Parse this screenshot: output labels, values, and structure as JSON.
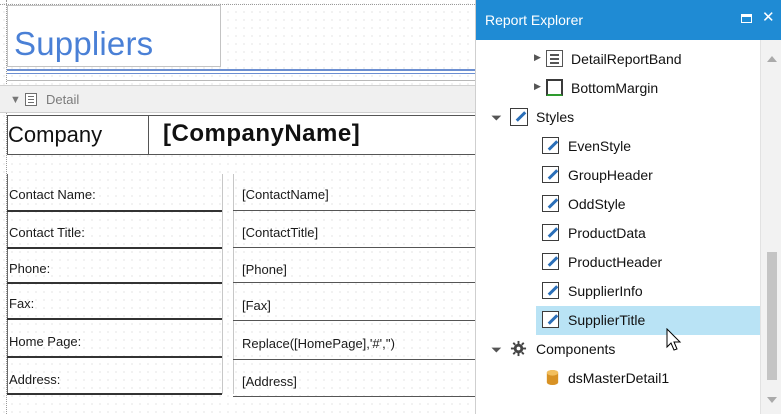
{
  "designer": {
    "report_title": "Suppliers",
    "band_label": "Detail",
    "company_label": "Company",
    "company_field": "[CompanyName]",
    "fields": [
      {
        "label": "Contact Name:",
        "value": "[ContactName]"
      },
      {
        "label": "Contact Title:",
        "value": "[ContactTitle]"
      },
      {
        "label": "Phone:",
        "value": "[Phone]"
      },
      {
        "label": "Fax:",
        "value": "[Fax]"
      },
      {
        "label": "Home Page:",
        "value": "Replace([HomePage],'#','')"
      },
      {
        "label": "Address:",
        "value": "[Address]"
      }
    ]
  },
  "explorer": {
    "title": "Report Explorer",
    "maximize_icon": "maximize-icon",
    "close_icon": "close-icon",
    "close_glyph": "✕",
    "bands": [
      {
        "label": "DetailReportBand",
        "icon": "detail-band-icon"
      },
      {
        "label": "BottomMargin",
        "icon": "bottom-margin-icon"
      }
    ],
    "styles_label": "Styles",
    "styles": [
      "EvenStyle",
      "GroupHeader",
      "OddStyle",
      "ProductData",
      "ProductHeader",
      "SupplierInfo",
      "SupplierTitle"
    ],
    "selected_style": "SupplierTitle",
    "components_label": "Components",
    "components": [
      "dsMasterDetail1"
    ]
  },
  "colors": {
    "title_blue": "#4a80d6",
    "panel_header": "#1f8bd4",
    "selection": "#b9e3f5"
  }
}
